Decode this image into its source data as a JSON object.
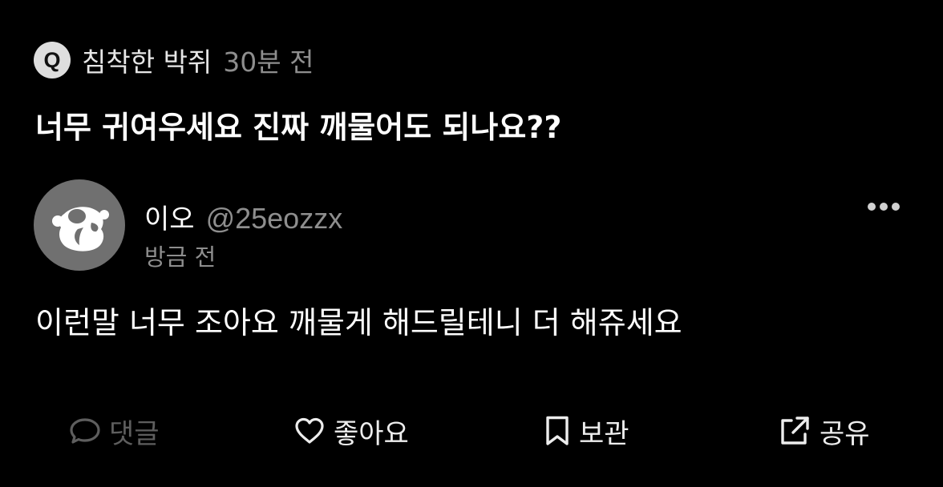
{
  "question": {
    "badge": "Q",
    "asker_name": "침착한 박쥐",
    "asked_time": "30분 전",
    "text": "너무 귀여우세요 진짜 깨물어도 되나요??"
  },
  "answer": {
    "display_name": "이오",
    "handle": "@25eozzx",
    "time": "방금 전",
    "text": "이런말 너무 조아요 깨물게 해드릴테니 더 해쥬세요",
    "more_icon": "more-horizontal-icon"
  },
  "actions": {
    "comment": {
      "label": "댓글",
      "icon": "comment-bubble-icon",
      "enabled": false
    },
    "like": {
      "label": "좋아요",
      "icon": "heart-icon"
    },
    "save": {
      "label": "보관",
      "icon": "bookmark-icon"
    },
    "share": {
      "label": "공유",
      "icon": "share-external-icon"
    }
  },
  "colors": {
    "background": "#000000",
    "primary_text": "#ffffff",
    "secondary_text": "#8e8e8e",
    "disabled_text": "#5e5e5e",
    "avatar_bg": "#707070"
  }
}
